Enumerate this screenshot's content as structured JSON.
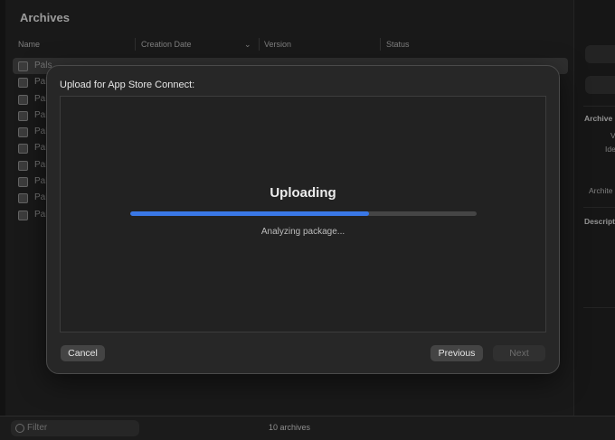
{
  "window": {
    "title": "Archives"
  },
  "table": {
    "columns": [
      "Name",
      "Creation Date",
      "Version",
      "Status"
    ],
    "rows": [
      "Pals",
      "Pal",
      "Pal",
      "Pal",
      "Pal",
      "Pal",
      "Pal",
      "Pal",
      "Pal",
      "Pal"
    ]
  },
  "right_panel": {
    "section1": "Archive",
    "line1": "V",
    "line2": "Ide",
    "line3": "Archite",
    "section2": "Descript"
  },
  "footer": {
    "filter_placeholder": "Filter",
    "count": "10 archives"
  },
  "dialog": {
    "title": "Upload for App Store Connect:",
    "heading": "Uploading",
    "status": "Analyzing package...",
    "progress": 0.69,
    "buttons": {
      "cancel": "Cancel",
      "previous": "Previous",
      "next": "Next"
    },
    "accent_color": "#3a78e6"
  }
}
